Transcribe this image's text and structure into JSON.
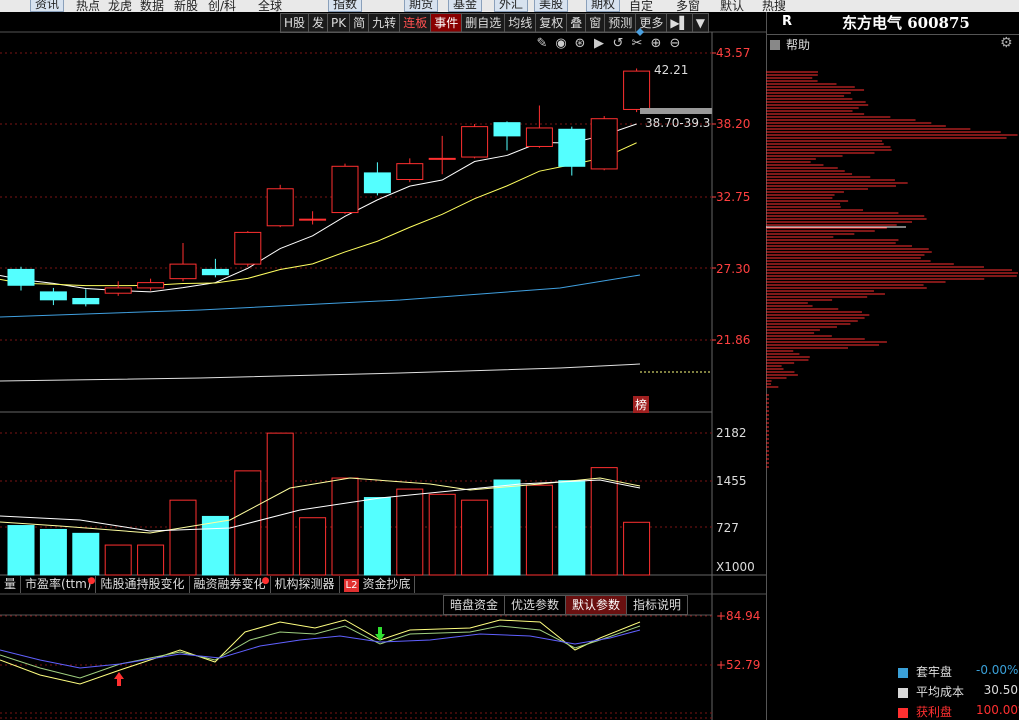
{
  "top_menu": [
    {
      "label": "资讯",
      "btn": true,
      "x": 30
    },
    {
      "label": "热点",
      "btn": false,
      "x": 76
    },
    {
      "label": "龙虎",
      "btn": false,
      "x": 108
    },
    {
      "label": "数据",
      "btn": false,
      "x": 140
    },
    {
      "label": "新股",
      "btn": false,
      "x": 174
    },
    {
      "label": "创/科",
      "btn": false,
      "x": 208
    },
    {
      "label": "全球",
      "btn": false,
      "x": 258
    },
    {
      "label": "指数",
      "btn": true,
      "x": 328
    },
    {
      "label": "期货",
      "btn": true,
      "x": 404
    },
    {
      "label": "基金",
      "btn": true,
      "x": 448
    },
    {
      "label": "外汇",
      "btn": true,
      "x": 494
    },
    {
      "label": "美股",
      "btn": true,
      "x": 534
    },
    {
      "label": "期权",
      "btn": true,
      "x": 586
    },
    {
      "label": "自定",
      "btn": false,
      "x": 629
    },
    {
      "label": "多窗",
      "btn": false,
      "x": 676
    },
    {
      "label": "默认",
      "btn": false,
      "x": 720
    },
    {
      "label": "热搜",
      "btn": false,
      "x": 762
    }
  ],
  "toolbar": [
    {
      "label": "H股",
      "style": ""
    },
    {
      "label": "发",
      "style": ""
    },
    {
      "label": "PK",
      "style": ""
    },
    {
      "label": "简",
      "style": ""
    },
    {
      "label": "九转",
      "style": ""
    },
    {
      "label": "连板",
      "style": "red"
    },
    {
      "label": "事件",
      "style": "hl"
    },
    {
      "label": "删自选",
      "style": ""
    },
    {
      "label": "均线",
      "style": ""
    },
    {
      "label": "复权",
      "style": ""
    },
    {
      "label": "叠",
      "style": ""
    },
    {
      "label": "窗",
      "style": ""
    },
    {
      "label": "预测",
      "style": ""
    },
    {
      "label": "更多",
      "style": ""
    },
    {
      "label": "▶▌",
      "style": ""
    },
    {
      "label": "▼",
      "style": ""
    }
  ],
  "stock": {
    "code_tag": "R",
    "name": "东方电气 600875"
  },
  "help_label": "帮助",
  "price_axis": {
    "labels": [
      "43.57",
      "38.20",
      "32.75",
      "27.30",
      "21.86"
    ]
  },
  "volume_axis": {
    "labels": [
      "2182",
      "1455",
      "727"
    ],
    "unit": "X1000"
  },
  "indicator_axis": {
    "labels": [
      "+84.94",
      "+52.79"
    ]
  },
  "annotations": {
    "high": "42.21",
    "range": "38.70-39.3",
    "bang": "榜"
  },
  "indicator_tabs": [
    {
      "label": "量",
      "dot": false
    },
    {
      "label": "市盈率(ttm)",
      "dot": true
    },
    {
      "label": "陆股通持股变化",
      "dot": false
    },
    {
      "label": "融资融券变化",
      "dot": true
    },
    {
      "label": "机构探测器",
      "dot": false
    },
    {
      "label": "资金抄底",
      "dot": false,
      "l2": "L2"
    }
  ],
  "sub_tabs": [
    {
      "label": "暗盘资金",
      "sel": false
    },
    {
      "label": "优选参数",
      "sel": false
    },
    {
      "label": "默认参数",
      "sel": true
    },
    {
      "label": "指标说明",
      "sel": false
    }
  ],
  "chip_legend": [
    {
      "label": "套牢盘",
      "value": "-0.00%",
      "color": "#3aa0d8",
      "value_color": "#3aa0d8"
    },
    {
      "label": "平均成本",
      "value": "30.50",
      "color": "#d8d8d8",
      "value_color": "#ddd"
    },
    {
      "label": "获利盘",
      "value": "100.00%",
      "color": "#ff3030",
      "value_color": "#ff3030"
    }
  ],
  "chart_data": {
    "type": "candlestick",
    "candles": [
      {
        "o": 27.2,
        "c": 26.0,
        "h": 27.4,
        "l": 25.6
      },
      {
        "o": 25.5,
        "c": 24.9,
        "h": 25.8,
        "l": 24.5
      },
      {
        "o": 25.0,
        "c": 24.6,
        "h": 25.7,
        "l": 24.4
      },
      {
        "o": 25.4,
        "c": 25.8,
        "h": 26.3,
        "l": 25.2
      },
      {
        "o": 25.8,
        "c": 26.2,
        "h": 26.5,
        "l": 25.6
      },
      {
        "o": 26.5,
        "c": 27.6,
        "h": 29.2,
        "l": 26.3
      },
      {
        "o": 27.2,
        "c": 26.8,
        "h": 28.0,
        "l": 26.6
      },
      {
        "o": 27.6,
        "c": 30.0,
        "h": 30.1,
        "l": 27.4
      },
      {
        "o": 30.5,
        "c": 33.3,
        "h": 33.6,
        "l": 30.4
      },
      {
        "o": 31.0,
        "c": 31.0,
        "h": 31.6,
        "l": 30.6
      },
      {
        "o": 31.5,
        "c": 35.0,
        "h": 35.2,
        "l": 31.4
      },
      {
        "o": 34.5,
        "c": 33.0,
        "h": 35.3,
        "l": 32.8
      },
      {
        "o": 34.0,
        "c": 35.2,
        "h": 35.6,
        "l": 33.8
      },
      {
        "o": 35.6,
        "c": 35.6,
        "h": 37.3,
        "l": 34.4
      },
      {
        "o": 35.7,
        "c": 38.0,
        "h": 38.2,
        "l": 35.6
      },
      {
        "o": 38.3,
        "c": 37.3,
        "h": 38.4,
        "l": 36.2
      },
      {
        "o": 36.5,
        "c": 37.9,
        "h": 39.6,
        "l": 36.4
      },
      {
        "o": 37.8,
        "c": 35.0,
        "h": 38.0,
        "l": 34.3
      },
      {
        "o": 34.8,
        "c": 38.6,
        "h": 38.8,
        "l": 34.7
      },
      {
        "o": 39.3,
        "c": 42.2,
        "h": 42.4,
        "l": 39.1
      }
    ],
    "volume": [
      760,
      700,
      640,
      460,
      460,
      1150,
      900,
      1600,
      2180,
      880,
      1490,
      1190,
      1320,
      1240,
      1150,
      1460,
      1380,
      1450,
      1650,
      810
    ],
    "ylim": [
      18.5,
      45.0
    ],
    "volume_ylim": [
      0,
      2182
    ]
  }
}
